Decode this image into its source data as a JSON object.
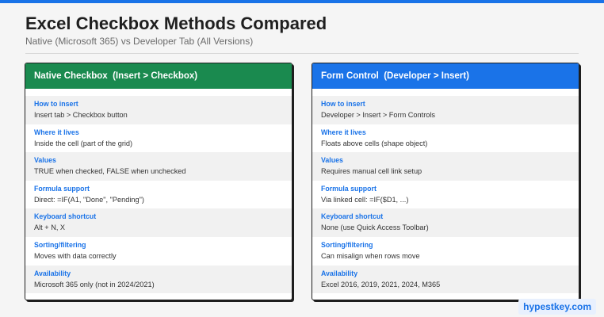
{
  "page": {
    "title": "Excel Checkbox Methods Compared",
    "subtitle": "Native (Microsoft 365)  vs  Developer Tab (All Versions)",
    "brand": "hypestkey.com"
  },
  "colors": {
    "native_header": "#1a8a4f",
    "form_header": "#1a73e8",
    "label_blue": "#1a73e8"
  },
  "native": {
    "header": "Native Checkbox  (Insert > Checkbox)",
    "rows": [
      {
        "label": "How to insert",
        "value": "Insert tab > Checkbox button"
      },
      {
        "label": "Where it lives",
        "value": "Inside the cell (part of the grid)"
      },
      {
        "label": "Values",
        "value": "TRUE when checked, FALSE when unchecked"
      },
      {
        "label": "Formula support",
        "value": "Direct: =IF(A1, \"Done\", \"Pending\")"
      },
      {
        "label": "Keyboard shortcut",
        "value": "Alt + N, X"
      },
      {
        "label": "Sorting/filtering",
        "value": "Moves with data correctly"
      },
      {
        "label": "Availability",
        "value": "Microsoft 365 only (not in 2024/2021)"
      }
    ]
  },
  "form": {
    "header": "Form Control  (Developer > Insert)",
    "rows": [
      {
        "label": "How to insert",
        "value": "Developer > Insert > Form Controls"
      },
      {
        "label": "Where it lives",
        "value": "Floats above cells (shape object)"
      },
      {
        "label": "Values",
        "value": "Requires manual cell link setup"
      },
      {
        "label": "Formula support",
        "value": "Via linked cell: =IF($D1, ...)"
      },
      {
        "label": "Keyboard shortcut",
        "value": "None (use Quick Access Toolbar)"
      },
      {
        "label": "Sorting/filtering",
        "value": "Can misalign when rows move"
      },
      {
        "label": "Availability",
        "value": "Excel 2016, 2019, 2021, 2024, M365"
      }
    ]
  }
}
